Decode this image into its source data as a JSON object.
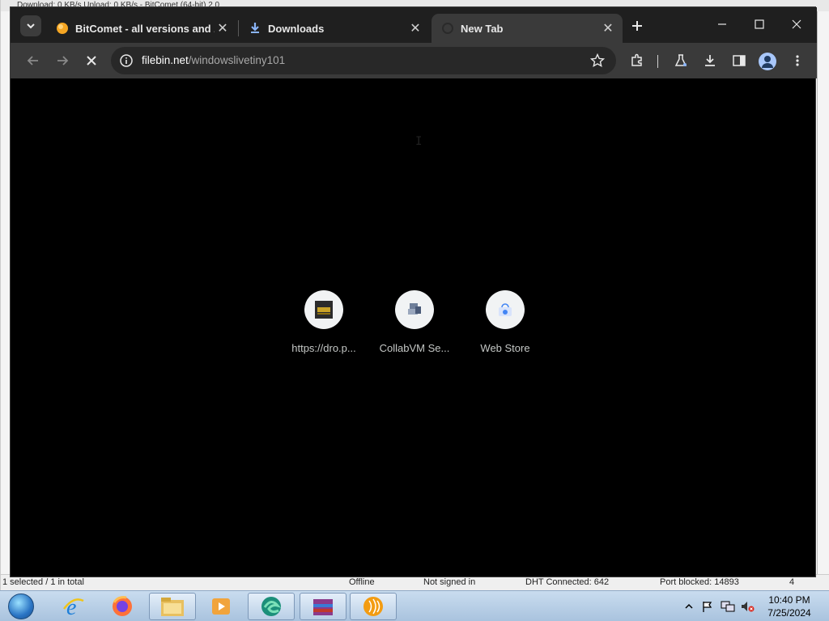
{
  "background_app": {
    "title": "Download: 0 KB/s  Upload: 0 KB/s - BitComet (64-bit) 2.0",
    "status": {
      "selection": "1 selected / 1 in total",
      "online": "Offline",
      "account": "Not signed in",
      "dht": "DHT Connected: 642",
      "port": "Port blocked: 14893",
      "count": "4"
    }
  },
  "browser": {
    "tabs": [
      {
        "title": "BitComet - all versions and zip",
        "favicon": "bitcomet-icon",
        "active": false
      },
      {
        "title": "Downloads",
        "favicon": "download-icon",
        "active": false
      },
      {
        "title": "New Tab",
        "favicon": "loading-spinner-icon",
        "active": true
      }
    ],
    "address": {
      "host": "filebin.net",
      "path": "/windowslivetiny101"
    },
    "shortcuts": [
      {
        "label": "https://dro.p...",
        "icon": "dropbox-like-site-icon"
      },
      {
        "label": "CollabVM Se...",
        "icon": "collabvm-icon"
      },
      {
        "label": "Web Store",
        "icon": "web-store-icon"
      }
    ]
  },
  "taskbar": {
    "apps": [
      "internet-explorer-icon",
      "firefox-icon",
      "file-explorer-icon",
      "media-player-icon",
      "edge-icon",
      "winrar-icon",
      "bitcomet-icon"
    ],
    "clock": {
      "time": "10:40 PM",
      "date": "7/25/2024"
    }
  },
  "colors": {
    "chrome_frame": "#1f1f1f",
    "chrome_toolbar": "#3a3a3a",
    "ntp_background": "#000000",
    "taskbar": "#b9cfe6"
  }
}
